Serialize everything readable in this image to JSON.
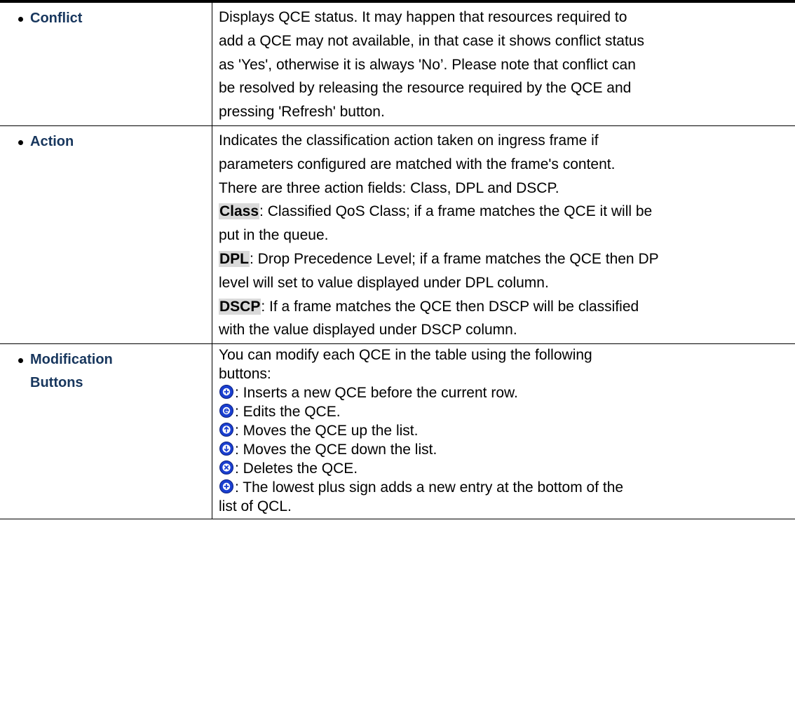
{
  "rows": {
    "conflict": {
      "name": "Conflict",
      "lines": [
        "Displays QCE status. It may happen that resources required to",
        "add a QCE may not available, in that case it shows conflict status",
        "as 'Yes', otherwise it is always 'No’. Please note that conflict can",
        "be resolved by releasing the resource required by the QCE and",
        "pressing 'Refresh' button."
      ]
    },
    "action": {
      "name": "Action",
      "intro": [
        "Indicates the classification action taken on ingress frame if",
        "parameters configured are matched with the frame's content.",
        "There are three action fields: Class, DPL and DSCP."
      ],
      "class_kw": "Class",
      "class_line1": ": Classified QoS Class; if a frame matches the QCE it will be",
      "class_line2": "put in the queue.",
      "dpl_kw": "DPL",
      "dpl_line1": ": Drop Precedence Level; if a frame matches the QCE then DP",
      "dpl_line2": "level will set to value displayed under DPL column.",
      "dscp_kw": "DSCP",
      "dscp_line1": ": If a frame matches the QCE then DSCP will be classified",
      "dscp_line2": "with the value displayed under DSCP column."
    },
    "modification": {
      "name_line1": "Modification",
      "name_line2": "Buttons",
      "intro": [
        "You can modify each QCE in the table using the following",
        "buttons:"
      ],
      "items": [
        {
          "icon": "plus-icon",
          "text": ": Inserts a new QCE before the current row."
        },
        {
          "icon": "edit-icon",
          "text": ": Edits the QCE."
        },
        {
          "icon": "up-arrow-icon",
          "text": ": Moves the QCE up the list."
        },
        {
          "icon": "down-arrow-icon",
          "text": ": Moves the QCE down the list."
        },
        {
          "icon": "delete-icon",
          "text": ": Deletes the QCE."
        },
        {
          "icon": "plus-icon",
          "text": ": The lowest plus sign adds a new entry at the bottom of the"
        }
      ],
      "last_line": "list of QCL."
    }
  },
  "colors": {
    "heading": "#17365d",
    "highlight": "#d9d9d9",
    "icon_blue": "#1a3fd0"
  }
}
